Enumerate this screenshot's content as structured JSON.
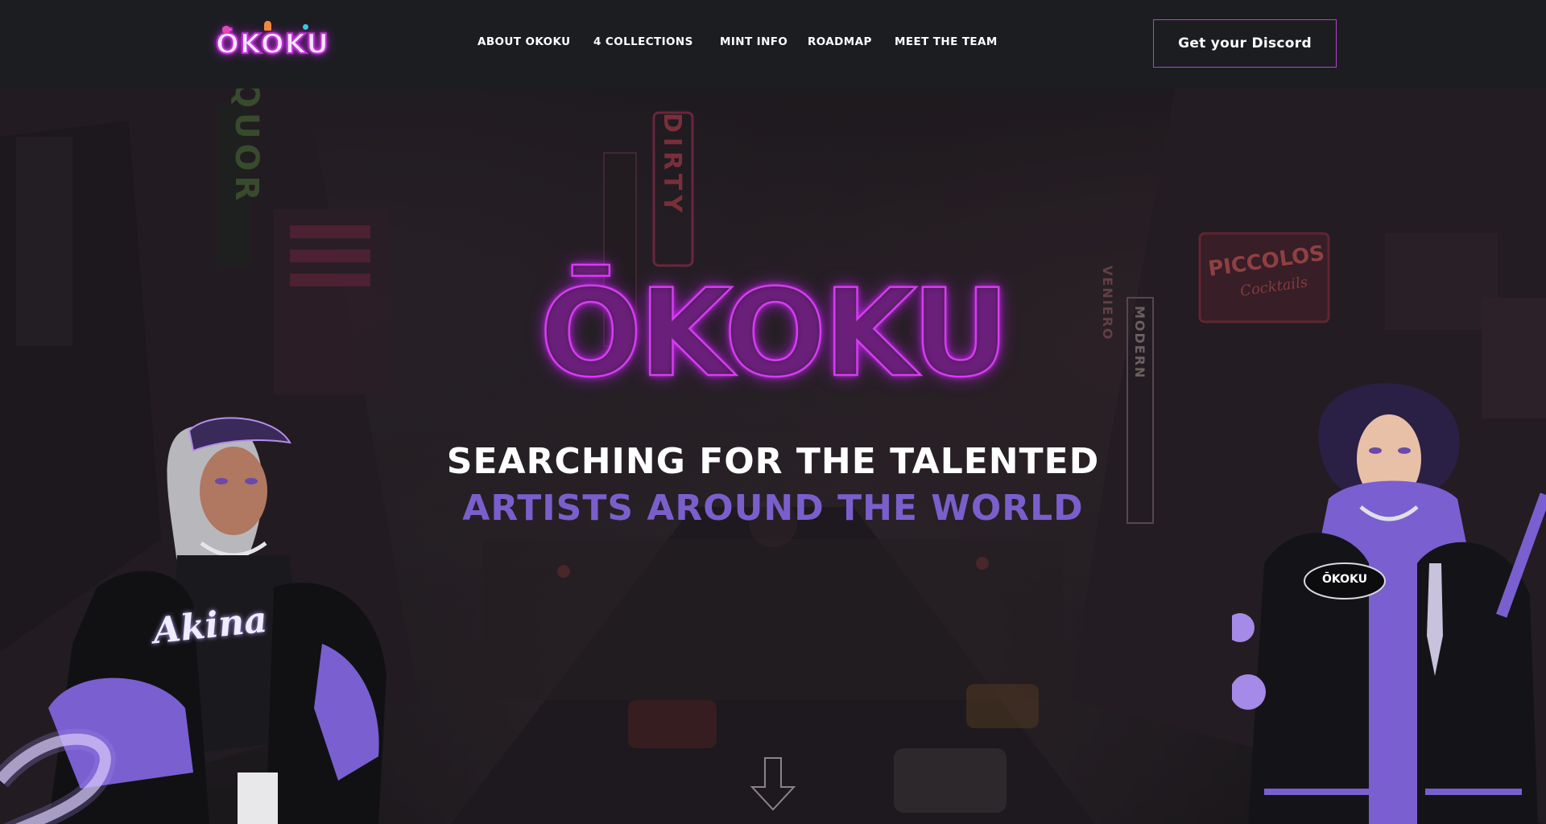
{
  "header": {
    "logo_text": "ŌKOKU",
    "nav": [
      {
        "label": "ABOUT OKOKU"
      },
      {
        "label": "4 COLLECTIONS"
      },
      {
        "label": "MINT INFO"
      },
      {
        "label": "ROADMAP"
      },
      {
        "label": "MEET THE TEAM"
      }
    ],
    "cta_label": "Get your Discord"
  },
  "hero": {
    "title": "ŌKOKU",
    "tagline_line1": "SEARCHING FOR THE TALENTED",
    "tagline_line2": "ARTISTS AROUND THE WORLD",
    "scroll_icon": "scroll-down-arrow-icon",
    "left_character_jacket_text": "Akina",
    "right_character_badge_text": "ŌKOKU",
    "signs": {
      "dirty": "DIRTY",
      "liquor": "QUOR",
      "piccolos": "PICCOLOS",
      "cocktails": "Cocktails",
      "veniero": "VENIERO",
      "modern": "MODERN"
    }
  },
  "colors": {
    "accent_pink": "#d63cf2",
    "accent_purple": "#7a5fcc",
    "header_bg": "#1c1d21"
  }
}
